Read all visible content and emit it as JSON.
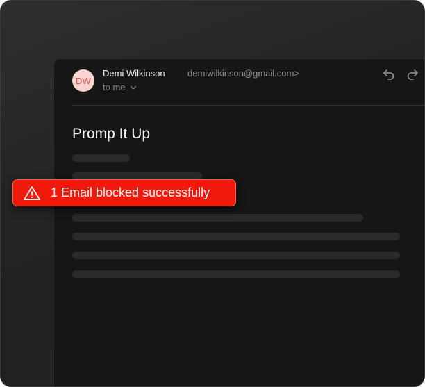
{
  "email": {
    "avatar_initials": "DW",
    "sender_name": "Demi Wilkinson",
    "sender_email": "demiwilkinson@gmail.com>",
    "recipient": "to me",
    "subject": "Promp It Up"
  },
  "toast": {
    "message": "1 Email blocked successfully",
    "icon": "warning-icon",
    "color": "#f0190b"
  },
  "actions": {
    "reply_icon": "reply-icon",
    "forward_icon": "forward-icon"
  },
  "colors": {
    "background": "#232323",
    "email_panel": "#161616",
    "avatar_bg": "#f9d4d0",
    "avatar_text": "#d9534f"
  }
}
